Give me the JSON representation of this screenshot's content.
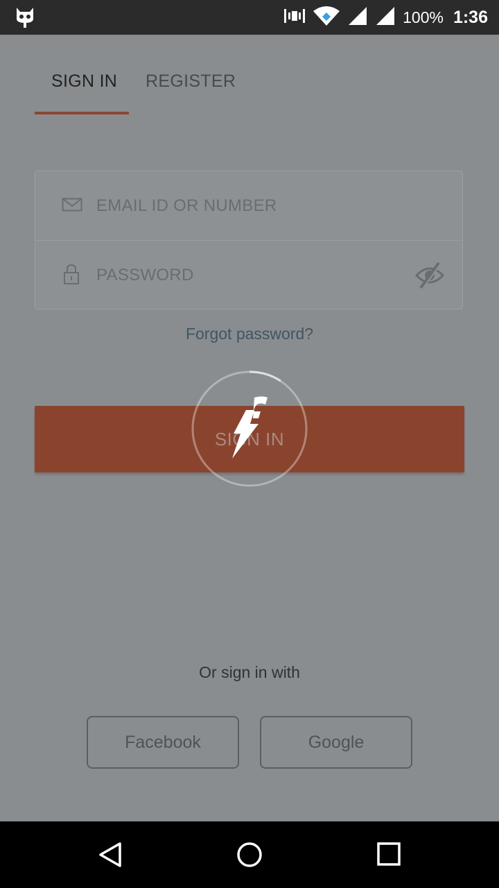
{
  "status_bar": {
    "battery": "100%",
    "time": "1:36",
    "icons": [
      "cyanogen-icon",
      "signal-strength-icon",
      "wifi-icon",
      "cell-signal-icon",
      "cell-signal-icon"
    ]
  },
  "tabs": [
    {
      "label": "SIGN IN",
      "active": true
    },
    {
      "label": "REGISTER",
      "active": false
    }
  ],
  "form": {
    "email_placeholder": "EMAIL ID OR NUMBER",
    "email_value": "",
    "password_placeholder": "PASSWORD",
    "password_value": ""
  },
  "forgot_password": "Forgot password?",
  "signin_button": "SIGN IN",
  "social": {
    "prompt": "Or sign in with",
    "facebook": "Facebook",
    "google": "Google"
  },
  "colors": {
    "accent": "#8a442e",
    "overlay_bg": "#8a8d8f",
    "link": "#3f5564"
  }
}
